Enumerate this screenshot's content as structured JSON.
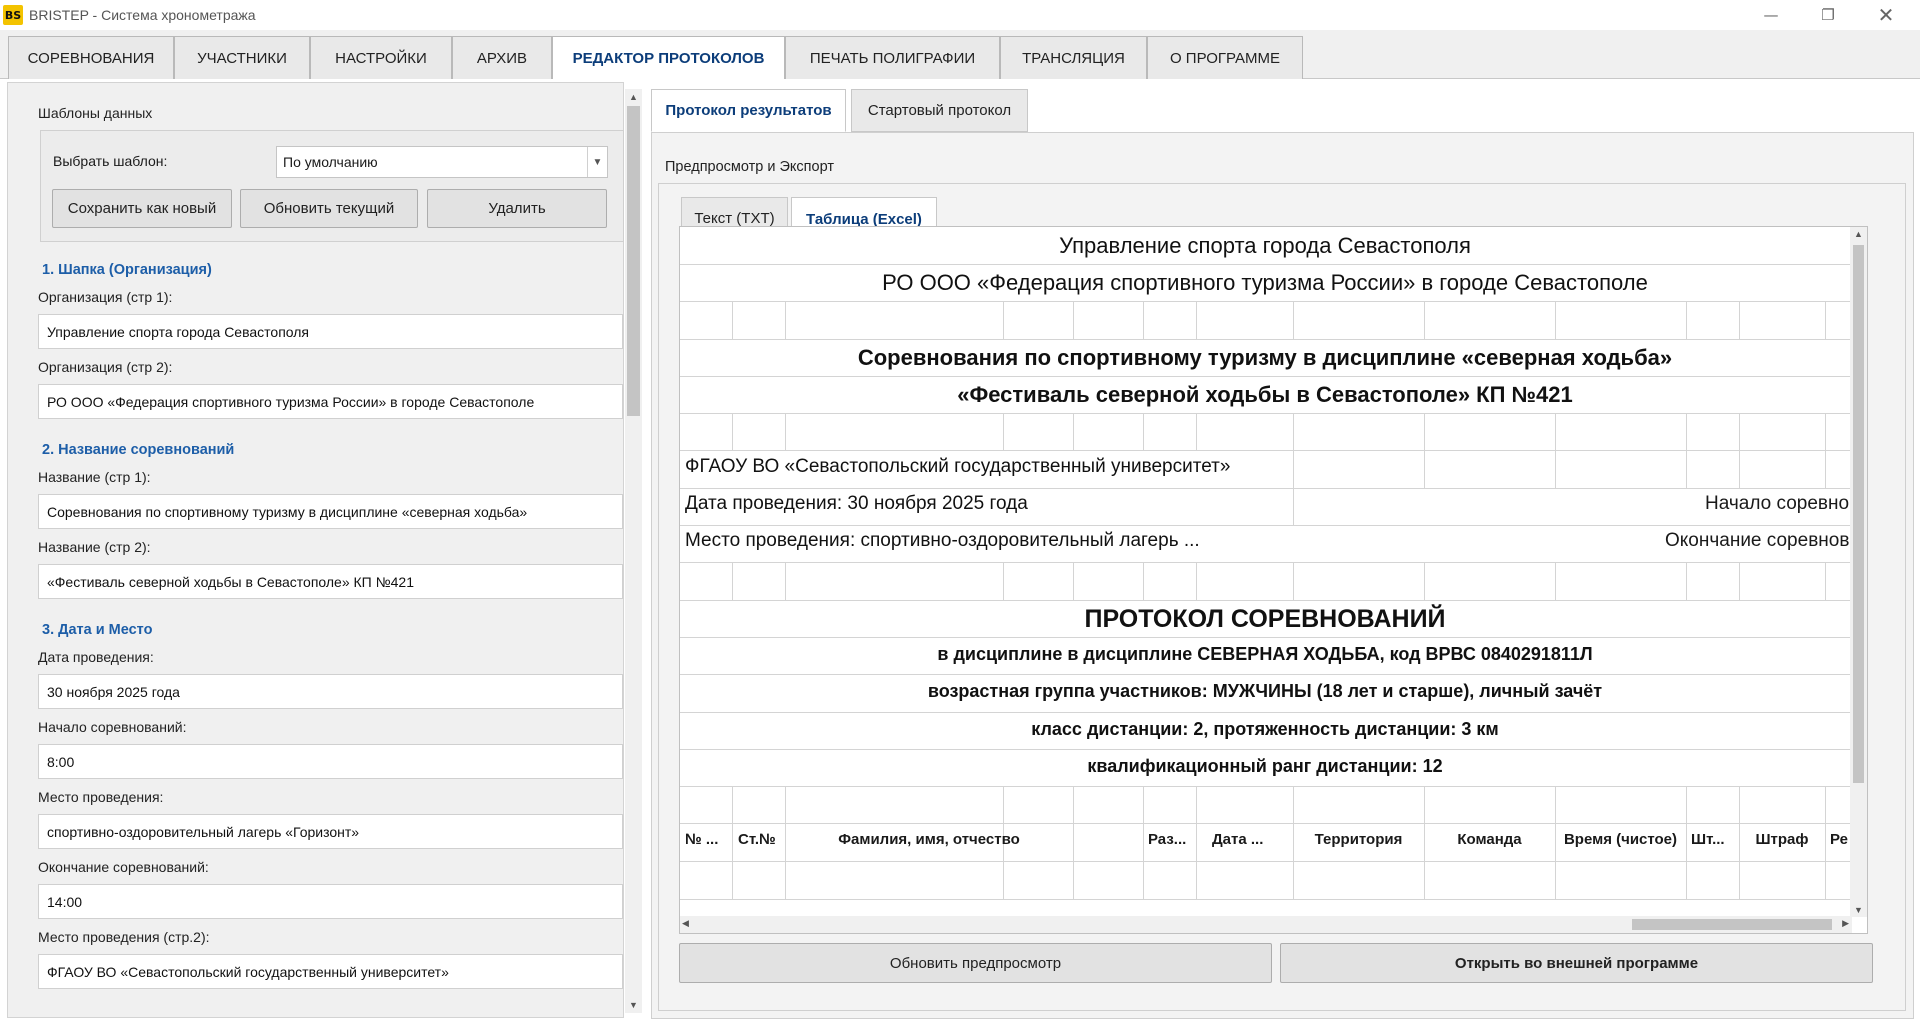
{
  "window": {
    "title": "BRISTEP - Система хронометража",
    "logo_text": "BS",
    "minimize_icon": "minimize-icon",
    "maximize_icon": "restore-icon",
    "close_icon": "close-icon"
  },
  "main_tabs": [
    "СОРЕВНОВАНИЯ",
    "УЧАСТНИКИ",
    "НАСТРОЙКИ",
    "АРХИВ",
    "РЕДАКТОР ПРОТОКОЛОВ",
    "ПЕЧАТЬ ПОЛИГРАФИИ",
    "ТРАНСЛЯЦИЯ",
    "О ПРОГРАММЕ"
  ],
  "active_main_tab": "РЕДАКТОР ПРОТОКОЛОВ",
  "left": {
    "templates_title": "Шаблоны данных",
    "select_label": "Выбрать шаблон:",
    "select_value": "По умолчанию",
    "save_new": "Сохранить как новый",
    "update_current": "Обновить текущий",
    "delete": "Удалить",
    "section1": "1. Шапка (Организация)",
    "org1_label": "Организация (стр 1):",
    "org1_value": "Управление спорта города Севастополя",
    "org2_label": "Организация (стр 2):",
    "org2_value": "РО ООО «Федерация спортивного туризма России» в городе Севастополе",
    "section2": "2. Название соревнований",
    "name1_label": "Название (стр 1):",
    "name1_value": "Соревнования по спортивному туризму в дисциплине «северная ходьба»",
    "name2_label": "Название (стр 2):",
    "name2_value": "«Фестиваль северной ходьбы в Севастополе»  КП №421",
    "section3": "3. Дата и Место",
    "date_label": "Дата проведения:",
    "date_value": "30 ноября 2025 года",
    "start_label": "Начало соревнований:",
    "start_value": "8:00",
    "place_label": "Место проведения:",
    "place_value": "спортивно-оздоровительный лагерь «Горизонт»",
    "end_label": "Окончание соревнований:",
    "end_value": "14:00",
    "place2_label": "Место проведения (стр.2):",
    "place2_value": "ФГАОУ ВО «Севастопольский государственный университет»"
  },
  "right": {
    "tabs": [
      "Протокол результатов",
      "Стартовый протокол"
    ],
    "active_tab": "Протокол результатов",
    "preview_label": "Предпросмотр и Экспорт",
    "subtabs": [
      "Текст (TXT)",
      "Таблица (Excel)"
    ],
    "active_subtab": "Таблица (Excel)",
    "refresh_button": "Обновить предпросмотр",
    "open_button": "Открыть во внешней программе"
  },
  "sheet": {
    "org1": "Управление спорта города Севастополя",
    "org2": "РО ООО «Федерация спортивного туризма России» в городе Севастополе",
    "title1": "Соревнования по спортивному туризму в дисциплине «северная ходьба»",
    "title2": "«Фестиваль северной ходьбы в Севастополе»  КП №421",
    "university": "ФГАОУ ВО «Севастопольский государственный университет»",
    "date": "Дата проведения: 30 ноября 2025 года",
    "start": "Начало соревно",
    "place": "Место проведения: спортивно-оздоровительный лагерь ...",
    "end": "Окончание соревнов",
    "protocol": "ПРОТОКОЛ СОРЕВНОВАНИЙ",
    "discipline": "в дисциплине в дисциплине СЕВЕРНАЯ ХОДЬБА, код ВРВС 0840291811Л",
    "age_group": "возрастная группа участников: МУЖЧИНЫ (18 лет и старше), личный зачёт",
    "distance_class": "класс дистанции: 2, протяженность дистанции: 3 км",
    "rank": "квалификационный ранг дистанции: 12",
    "headers": [
      "№ ...",
      "Ст.№",
      "Фамилия, имя, отчество",
      "Раз...",
      "Дата ...",
      "Территория",
      "Команда",
      "Время (чистое)",
      "Шт...",
      "Штраф",
      "Ре"
    ]
  },
  "colors": {
    "accent": "#0c3d7a",
    "section": "#1d5ea8",
    "logo": "#f3c300"
  }
}
